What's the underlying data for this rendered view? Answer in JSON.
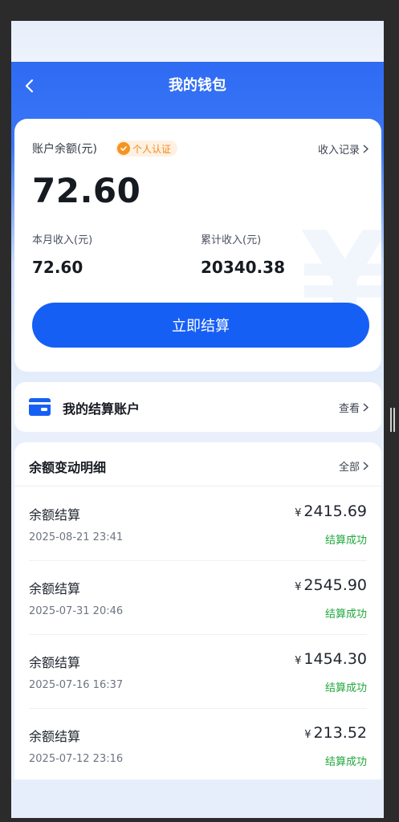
{
  "header": {
    "title": "我的钱包"
  },
  "balance_card": {
    "label": "账户余额(元)",
    "badge": "个人认证",
    "records_link": "收入记录",
    "balance": "72.60",
    "month_label": "本月收入(元)",
    "month_value": "72.60",
    "total_label": "累计收入(元)",
    "total_value": "20340.38",
    "settle_button": "立即结算"
  },
  "account": {
    "label": "我的结算账户",
    "view_link": "查看"
  },
  "details": {
    "title": "余额变动明细",
    "all_link": "全部",
    "currency": "¥",
    "rows": [
      {
        "name": "余额结算",
        "date": "2025-08-21 23:41",
        "amount": "2415.69",
        "status": "结算成功"
      },
      {
        "name": "余额结算",
        "date": "2025-07-31 20:46",
        "amount": "2545.90",
        "status": "结算成功"
      },
      {
        "name": "余额结算",
        "date": "2025-07-16 16:37",
        "amount": "1454.30",
        "status": "结算成功"
      },
      {
        "name": "余额结算",
        "date": "2025-07-12 23:16",
        "amount": "213.52",
        "status": "结算成功"
      }
    ]
  },
  "colors": {
    "primary": "#165ff5",
    "success": "#20a83c",
    "badge": "#f5941f"
  },
  "icons": [
    "back-arrow-icon",
    "check-badge-icon",
    "chevron-right-icon",
    "wallet-card-icon"
  ]
}
